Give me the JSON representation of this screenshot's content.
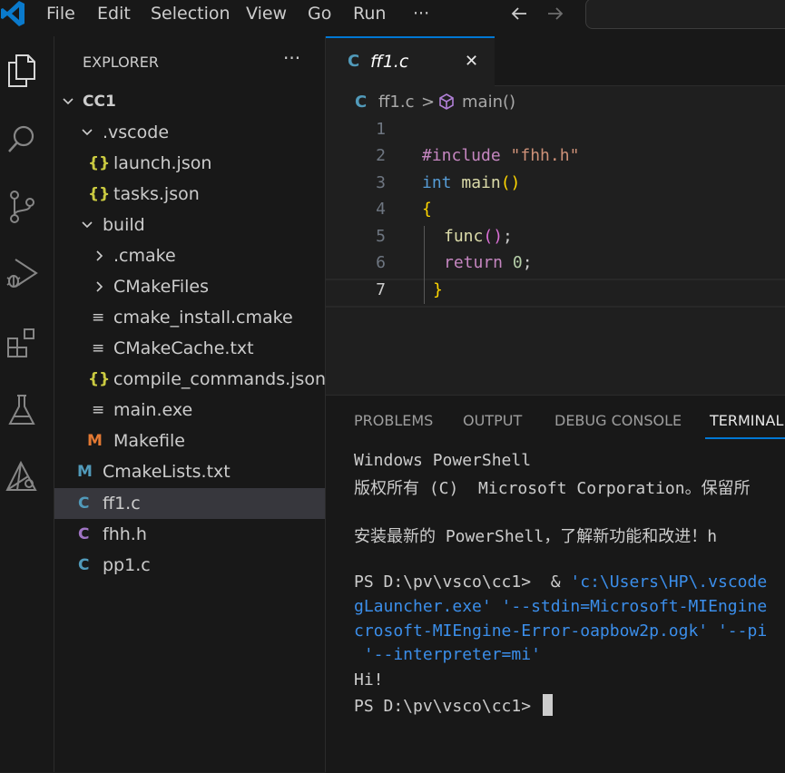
{
  "menu": {
    "items": [
      "File",
      "Edit",
      "Selection",
      "View",
      "Go",
      "Run",
      "···"
    ]
  },
  "explorer": {
    "title": "EXPLORER",
    "more": "···",
    "tree": [
      {
        "label": "CC1",
        "type": "root-folder",
        "expanded": true
      },
      {
        "label": ".vscode",
        "type": "folder",
        "expanded": true
      },
      {
        "label": "launch.json",
        "type": "json"
      },
      {
        "label": "tasks.json",
        "type": "json"
      },
      {
        "label": "build",
        "type": "folder",
        "expanded": true
      },
      {
        "label": ".cmake",
        "type": "folder",
        "expanded": false
      },
      {
        "label": "CMakeFiles",
        "type": "folder",
        "expanded": false
      },
      {
        "label": "cmake_install.cmake",
        "type": "text"
      },
      {
        "label": "CMakeCache.txt",
        "type": "text"
      },
      {
        "label": "compile_commands.json",
        "type": "json"
      },
      {
        "label": "main.exe",
        "type": "text"
      },
      {
        "label": "Makefile",
        "type": "makefile"
      },
      {
        "label": "CmakeLists.txt",
        "type": "cmake"
      },
      {
        "label": "ff1.c",
        "type": "c",
        "selected": true
      },
      {
        "label": "fhh.h",
        "type": "h"
      },
      {
        "label": "pp1.c",
        "type": "c"
      }
    ],
    "icons": {
      "json": "{}",
      "c": "C",
      "h": "C",
      "makefile": "M",
      "cmake": "M",
      "text": "≡"
    }
  },
  "colors": {
    "accent": "#0078d4",
    "c_icon": "#519aba",
    "h_icon": "#a074c4",
    "makefile_icon": "#e37933",
    "cmake_icon": "#519aba",
    "json_icon": "#cbcb41"
  },
  "tab": {
    "icon": "C",
    "label": "ff1.c",
    "close": "✕"
  },
  "breadcrumb": {
    "file_icon": "C",
    "file": "ff1.c",
    "separator": ">",
    "symbol": "main()"
  },
  "code": {
    "line_numbers": [
      "1",
      "2",
      "3",
      "4",
      "5",
      "6",
      "7"
    ],
    "include_kw": "#include",
    "include_str": "\"fhh.h\"",
    "int_kw": "int",
    "main_fn": "main",
    "main_parens": "()",
    "open_brace": "{",
    "func_call": "func",
    "func_parens": "()",
    "semicolon": ";",
    "return_kw": "return",
    "zero": "0",
    "close_brace": "}"
  },
  "panel": {
    "tabs": [
      "PROBLEMS",
      "OUTPUT",
      "DEBUG CONSOLE",
      "TERMINAL"
    ],
    "terminal": {
      "line1": "Windows PowerShell",
      "line2": "版权所有 (C)  Microsoft Corporation。保留所",
      "line3": "安装最新的 PowerShell，了解新功能和改进！h",
      "prompt1": "PS D:\\pv\\vsco\\cc1>  & ",
      "cmd1": "'c:\\Users\\HP\\.vscode",
      "cmd2": "gLauncher.exe' '--stdin=Microsoft-MIEngine",
      "cmd3": "crosoft-MIEngine-Error-oapbow2p.ogk' '--pi",
      "cmd4": " '--interpreter=mi'",
      "output": "Hi!",
      "prompt2": "PS D:\\pv\\vsco\\cc1> "
    }
  }
}
